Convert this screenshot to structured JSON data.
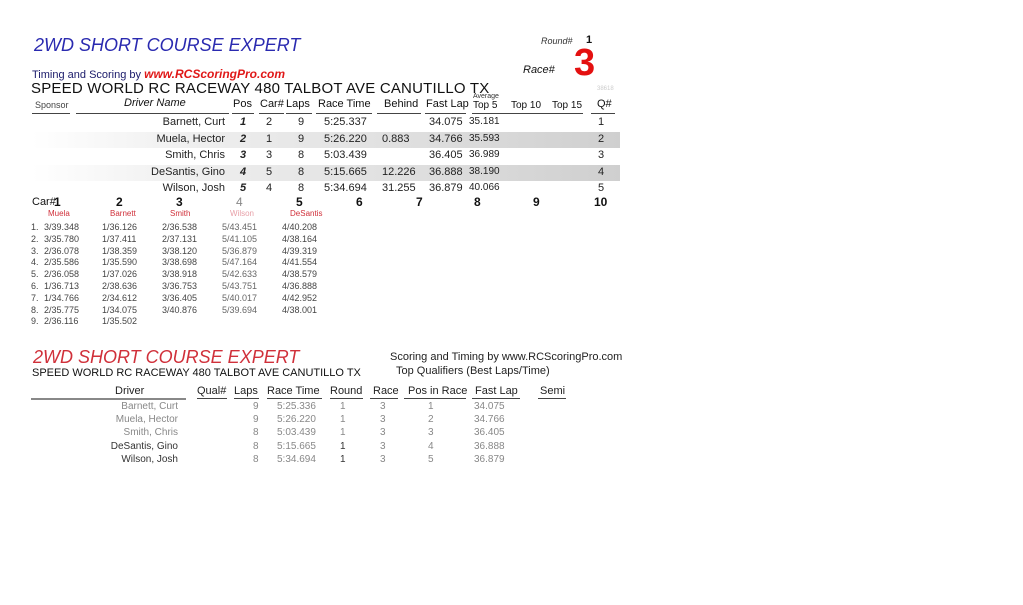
{
  "header": {
    "class_title": "2WD SHORT COURSE EXPERT",
    "timing_label": "Timing and Scoring by",
    "brand": "www.RCScoringPro.com",
    "venue": "SPEED WORLD RC RACEWAY 480 TALBOT AVE CANUTILLO TX",
    "round_label": "Round#",
    "round_value": "1",
    "race_label": "Race#",
    "race_value": "3",
    "faint_code": "38618"
  },
  "results": {
    "columns": {
      "sponsor": "Sponsor",
      "driver": "Driver Name",
      "pos": "Pos",
      "car": "Car#",
      "laps": "Laps",
      "race_time": "Race Time",
      "behind": "Behind",
      "fast_lap": "Fast Lap",
      "average": "Average",
      "top5": "Top 5",
      "top10": "Top 10",
      "top15": "Top 15",
      "q": "Q#"
    },
    "rows": [
      {
        "driver": "Barnett, Curt",
        "pos": "1",
        "car": "2",
        "laps": "9",
        "race_time": "5:25.337",
        "behind": "",
        "fast_lap": "34.075",
        "top5": "35.181",
        "top10": "",
        "top15": "",
        "q": "1"
      },
      {
        "driver": "Muela, Hector",
        "pos": "2",
        "car": "1",
        "laps": "9",
        "race_time": "5:26.220",
        "behind": "0.883",
        "fast_lap": "34.766",
        "top5": "35.593",
        "top10": "",
        "top15": "",
        "q": "2"
      },
      {
        "driver": "Smith, Chris",
        "pos": "3",
        "car": "3",
        "laps": "8",
        "race_time": "5:03.439",
        "behind": "",
        "fast_lap": "36.405",
        "top5": "36.989",
        "top10": "",
        "top15": "",
        "q": "3"
      },
      {
        "driver": "DeSantis, Gino",
        "pos": "4",
        "car": "5",
        "laps": "8",
        "race_time": "5:15.665",
        "behind": "12.226",
        "fast_lap": "36.888",
        "top5": "38.190",
        "top10": "",
        "top15": "",
        "q": "4"
      },
      {
        "driver": "Wilson, Josh",
        "pos": "5",
        "car": "4",
        "laps": "8",
        "race_time": "5:34.694",
        "behind": "31.255",
        "fast_lap": "36.879",
        "top5": "40.066",
        "top10": "",
        "top15": "",
        "q": "5"
      }
    ]
  },
  "laps": {
    "car_label": "Car#",
    "cars": [
      {
        "num": "1",
        "driver": "Muela",
        "laps": [
          "3/39.348",
          "3/35.780",
          "2/36.078",
          "2/35.586",
          "2/36.058",
          "1/36.713",
          "1/34.766",
          "2/35.775",
          "2/36.116"
        ]
      },
      {
        "num": "2",
        "driver": "Barnett",
        "laps": [
          "1/36.126",
          "1/37.411",
          "1/38.359",
          "1/35.590",
          "1/37.026",
          "2/38.636",
          "2/34.612",
          "1/34.075",
          "1/35.502"
        ]
      },
      {
        "num": "3",
        "driver": "Smith",
        "laps": [
          "2/36.538",
          "2/37.131",
          "3/38.120",
          "3/38.698",
          "3/38.918",
          "3/36.753",
          "3/36.405",
          "3/40.876"
        ]
      },
      {
        "num": "4",
        "driver": "Wilson",
        "laps": [
          "5/43.451",
          "5/41.105",
          "5/36.879",
          "5/47.164",
          "5/42.633",
          "5/43.751",
          "5/40.017",
          "5/39.694"
        ]
      },
      {
        "num": "5",
        "driver": "DeSantis",
        "laps": [
          "4/40.208",
          "4/38.164",
          "4/39.319",
          "4/41.554",
          "4/38.579",
          "4/36.888",
          "4/42.952",
          "4/38.001"
        ]
      },
      {
        "num": "6",
        "driver": "",
        "laps": []
      },
      {
        "num": "7",
        "driver": "",
        "laps": []
      },
      {
        "num": "8",
        "driver": "",
        "laps": []
      },
      {
        "num": "9",
        "driver": "",
        "laps": []
      },
      {
        "num": "10",
        "driver": "",
        "laps": []
      }
    ],
    "lap_index": [
      "1.",
      "2.",
      "3.",
      "4.",
      "5.",
      "6.",
      "7.",
      "8.",
      "9."
    ]
  },
  "qualifiers": {
    "class_title": "2WD SHORT COURSE EXPERT",
    "venue": "SPEED WORLD RC RACEWAY 480 TALBOT AVE CANUTILLO TX",
    "scoring_label": "Scoring and Timing by www.RCScoringPro.com",
    "subtitle": "Top Qualifiers (Best Laps/Time)",
    "columns": {
      "driver": "Driver",
      "qual": "Qual#",
      "laps": "Laps",
      "race_time": "Race Time",
      "round": "Round",
      "race": "Race",
      "pos_in_race": "Pos in Race",
      "fast_lap": "Fast Lap",
      "semi": "Semi"
    },
    "rows": [
      {
        "driver": "Barnett, Curt",
        "qual": "",
        "laps": "9",
        "race_time": "5:25.336",
        "round": "1",
        "race": "3",
        "pos_in_race": "1",
        "fast_lap": "34.075",
        "semi": ""
      },
      {
        "driver": "Muela, Hector",
        "qual": "",
        "laps": "9",
        "race_time": "5:26.220",
        "round": "1",
        "race": "3",
        "pos_in_race": "2",
        "fast_lap": "34.766",
        "semi": ""
      },
      {
        "driver": "Smith, Chris",
        "qual": "",
        "laps": "8",
        "race_time": "5:03.439",
        "round": "1",
        "race": "3",
        "pos_in_race": "3",
        "fast_lap": "36.405",
        "semi": ""
      },
      {
        "driver": "DeSantis, Gino",
        "qual": "",
        "laps": "8",
        "race_time": "5:15.665",
        "round": "1",
        "race": "3",
        "pos_in_race": "4",
        "fast_lap": "36.888",
        "semi": ""
      },
      {
        "driver": "Wilson, Josh",
        "qual": "",
        "laps": "8",
        "race_time": "5:34.694",
        "round": "1",
        "race": "3",
        "pos_in_race": "5",
        "fast_lap": "36.879",
        "semi": ""
      }
    ]
  }
}
